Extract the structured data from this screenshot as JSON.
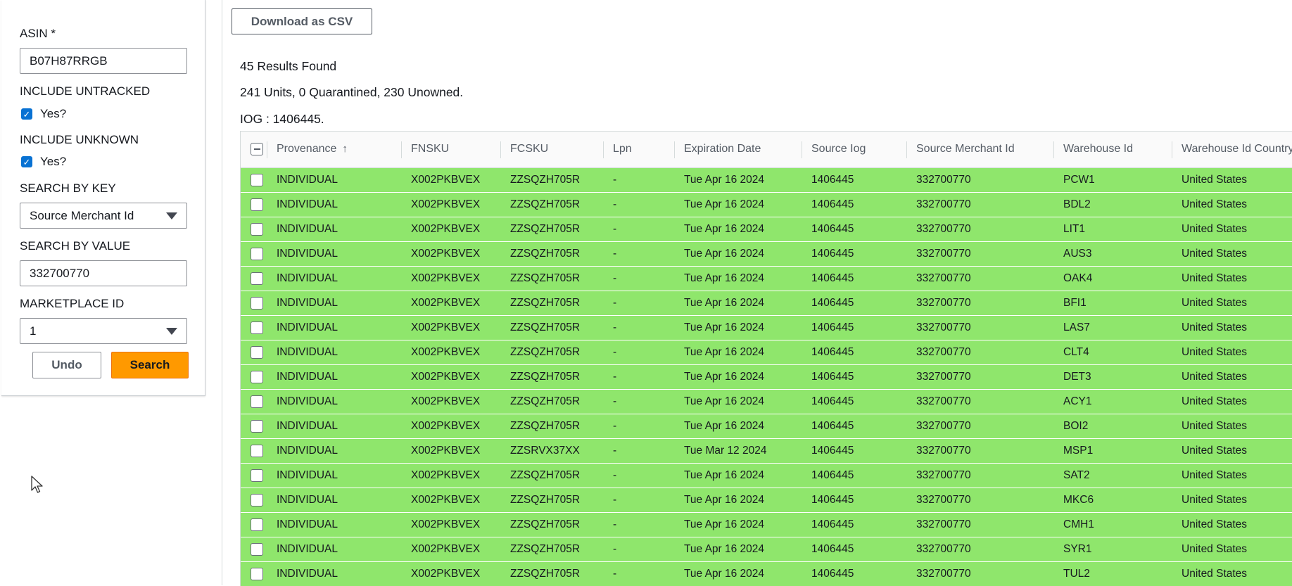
{
  "search_panel": {
    "asin_label": "ASIN *",
    "asin_value": "B07H87RRGB",
    "include_untracked_label": "INCLUDE UNTRACKED",
    "include_untracked_option": "Yes?",
    "include_untracked_checked": true,
    "include_unknown_label": "INCLUDE UNKNOWN",
    "include_unknown_option": "Yes?",
    "include_unknown_checked": true,
    "search_by_key_label": "SEARCH BY KEY",
    "search_by_key_value": "Source Merchant Id",
    "search_by_value_label": "SEARCH BY VALUE",
    "search_by_value_value": "332700770",
    "marketplace_label": "MARKETPLACE ID",
    "marketplace_value": "1",
    "undo_label": "Undo",
    "search_label": "Search"
  },
  "toolbar": {
    "download_csv_label": "Download as CSV"
  },
  "summary": {
    "results": "45 Results Found",
    "units": "241 Units, 0 Quarantined, 230 Unowned.",
    "iog": "IOG : 1406445."
  },
  "colors": {
    "row_highlight": "#8fe66c",
    "search_button": "#ff9900",
    "checkbox": "#0972d3"
  },
  "table": {
    "sort_icon": "arrow-up-icon",
    "columns": [
      "Provenance",
      "FNSKU",
      "FCSKU",
      "Lpn",
      "Expiration Date",
      "Source Iog",
      "Source Merchant Id",
      "Warehouse Id",
      "Warehouse Id Country"
    ],
    "rows": [
      [
        "INDIVIDUAL",
        "X002PKBVEX",
        "ZZSQZH705R",
        "-",
        "Tue Apr 16 2024",
        "1406445",
        "332700770",
        "PCW1",
        "United States"
      ],
      [
        "INDIVIDUAL",
        "X002PKBVEX",
        "ZZSQZH705R",
        "-",
        "Tue Apr 16 2024",
        "1406445",
        "332700770",
        "BDL2",
        "United States"
      ],
      [
        "INDIVIDUAL",
        "X002PKBVEX",
        "ZZSQZH705R",
        "-",
        "Tue Apr 16 2024",
        "1406445",
        "332700770",
        "LIT1",
        "United States"
      ],
      [
        "INDIVIDUAL",
        "X002PKBVEX",
        "ZZSQZH705R",
        "-",
        "Tue Apr 16 2024",
        "1406445",
        "332700770",
        "AUS3",
        "United States"
      ],
      [
        "INDIVIDUAL",
        "X002PKBVEX",
        "ZZSQZH705R",
        "-",
        "Tue Apr 16 2024",
        "1406445",
        "332700770",
        "OAK4",
        "United States"
      ],
      [
        "INDIVIDUAL",
        "X002PKBVEX",
        "ZZSQZH705R",
        "-",
        "Tue Apr 16 2024",
        "1406445",
        "332700770",
        "BFI1",
        "United States"
      ],
      [
        "INDIVIDUAL",
        "X002PKBVEX",
        "ZZSQZH705R",
        "-",
        "Tue Apr 16 2024",
        "1406445",
        "332700770",
        "LAS7",
        "United States"
      ],
      [
        "INDIVIDUAL",
        "X002PKBVEX",
        "ZZSQZH705R",
        "-",
        "Tue Apr 16 2024",
        "1406445",
        "332700770",
        "CLT4",
        "United States"
      ],
      [
        "INDIVIDUAL",
        "X002PKBVEX",
        "ZZSQZH705R",
        "-",
        "Tue Apr 16 2024",
        "1406445",
        "332700770",
        "DET3",
        "United States"
      ],
      [
        "INDIVIDUAL",
        "X002PKBVEX",
        "ZZSQZH705R",
        "-",
        "Tue Apr 16 2024",
        "1406445",
        "332700770",
        "ACY1",
        "United States"
      ],
      [
        "INDIVIDUAL",
        "X002PKBVEX",
        "ZZSQZH705R",
        "-",
        "Tue Apr 16 2024",
        "1406445",
        "332700770",
        "BOI2",
        "United States"
      ],
      [
        "INDIVIDUAL",
        "X002PKBVEX",
        "ZZSRVX37XX",
        "-",
        "Tue Mar 12 2024",
        "1406445",
        "332700770",
        "MSP1",
        "United States"
      ],
      [
        "INDIVIDUAL",
        "X002PKBVEX",
        "ZZSQZH705R",
        "-",
        "Tue Apr 16 2024",
        "1406445",
        "332700770",
        "SAT2",
        "United States"
      ],
      [
        "INDIVIDUAL",
        "X002PKBVEX",
        "ZZSQZH705R",
        "-",
        "Tue Apr 16 2024",
        "1406445",
        "332700770",
        "MKC6",
        "United States"
      ],
      [
        "INDIVIDUAL",
        "X002PKBVEX",
        "ZZSQZH705R",
        "-",
        "Tue Apr 16 2024",
        "1406445",
        "332700770",
        "CMH1",
        "United States"
      ],
      [
        "INDIVIDUAL",
        "X002PKBVEX",
        "ZZSQZH705R",
        "-",
        "Tue Apr 16 2024",
        "1406445",
        "332700770",
        "SYR1",
        "United States"
      ],
      [
        "INDIVIDUAL",
        "X002PKBVEX",
        "ZZSQZH705R",
        "-",
        "Tue Apr 16 2024",
        "1406445",
        "332700770",
        "TUL2",
        "United States"
      ]
    ]
  }
}
